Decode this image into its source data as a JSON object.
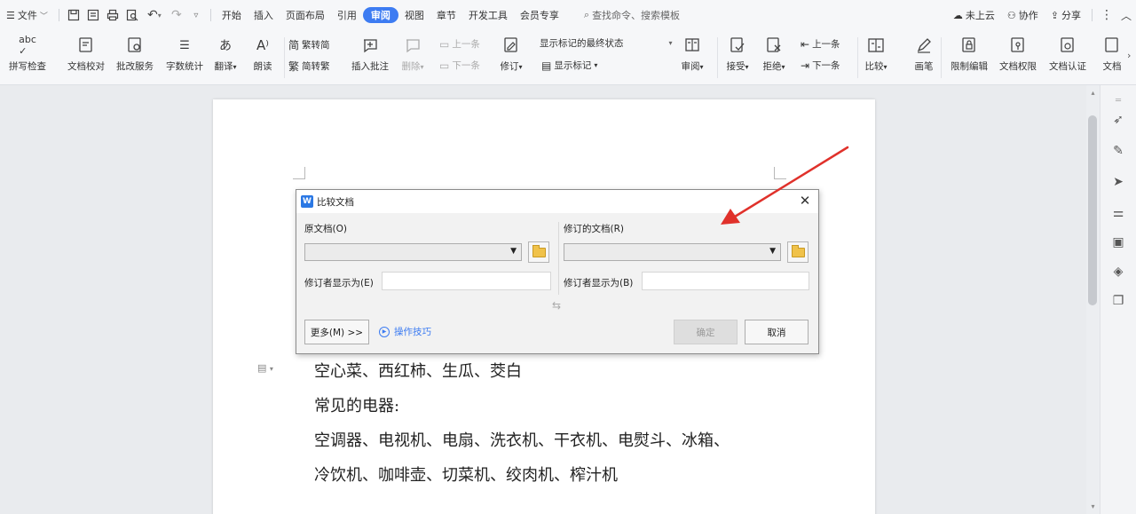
{
  "menubar": {
    "file_label": "文件",
    "tabs": [
      "开始",
      "插入",
      "页面布局",
      "引用",
      "审阅",
      "视图",
      "章节",
      "开发工具",
      "会员专享"
    ],
    "active_tab": "审阅",
    "search_label": "查找命令、搜索模板",
    "cloud_label": "未上云",
    "collab_label": "协作",
    "share_label": "分享"
  },
  "ribbon": {
    "spell_check": "拼写检查",
    "doc_proof": "文档校对",
    "batch_service": "批改服务",
    "word_count": "字数统计",
    "translate": "翻译",
    "read_aloud": "朗读",
    "trad_to_simp": "繁转简",
    "simp_to_trad": "简转繁",
    "insert_comment": "插入批注",
    "delete": "删除",
    "prev_comment": "上一条",
    "next_comment": "下一条",
    "track_changes": "修订",
    "display_state": "显示标记的最终状态",
    "show_markup": "显示标记",
    "review": "审阅",
    "accept": "接受",
    "reject": "拒绝",
    "prev_change": "上一条",
    "next_change": "下一条",
    "compare": "比较",
    "pen": "画笔",
    "restrict_edit": "限制编辑",
    "doc_permission": "文档权限",
    "doc_auth": "文档认证",
    "doc_more": "文档"
  },
  "dialog": {
    "title": "比较文档",
    "original_label": "原文档(O)",
    "revised_label": "修订的文档(R)",
    "original_reviewer_label": "修订者显示为(E)",
    "revised_reviewer_label": "修订者显示为(B)",
    "more_button": "更多(M) >>",
    "tips_link": "操作技巧",
    "ok_button": "确定",
    "cancel_button": "取消"
  },
  "document": {
    "lines": [
      "空心菜、西红柿、生瓜、茭白",
      "常见的电器:",
      "空调器、电视机、电扇、洗衣机、干衣机、电熨斗、冰箱、",
      "冷饮机、咖啡壶、切菜机、绞肉机、榨汁机"
    ]
  },
  "colors": {
    "accent": "#3d7cf2",
    "annotation_arrow": "#e0312b"
  }
}
